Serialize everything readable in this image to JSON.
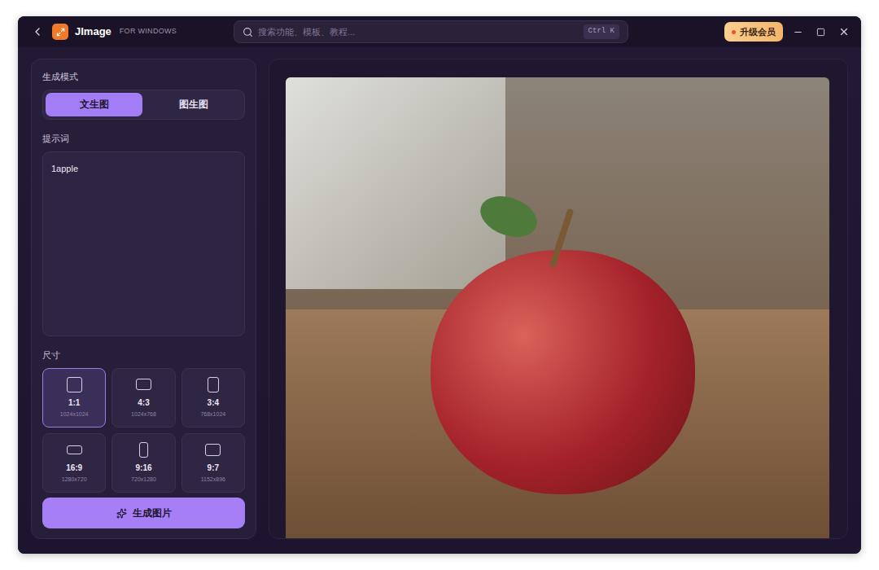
{
  "window": {
    "title": "JImage",
    "subtitle": "FOR WINDOWS"
  },
  "search": {
    "placeholder": "搜索功能、模板、教程...",
    "shortcut": "Ctrl K"
  },
  "upgrade_button": {
    "label": "升级会员"
  },
  "mode": {
    "label": "生成模式",
    "tabs": [
      {
        "label": "文生图",
        "selected": true
      },
      {
        "label": "图生图",
        "selected": false
      }
    ]
  },
  "prompt": {
    "label": "提示词",
    "value": "1apple"
  },
  "size": {
    "label": "尺寸",
    "options": [
      {
        "ratio": "1:1",
        "resolution": "1024x1024",
        "selected": true
      },
      {
        "ratio": "4:3",
        "resolution": "1024x768",
        "selected": false
      },
      {
        "ratio": "3:4",
        "resolution": "768x1024",
        "selected": false
      },
      {
        "ratio": "16:9",
        "resolution": "1280x720",
        "selected": false
      },
      {
        "ratio": "9:16",
        "resolution": "720x1280",
        "selected": false
      },
      {
        "ratio": "9:7",
        "resolution": "1152x896",
        "selected": false
      }
    ]
  },
  "generate_button": {
    "label": "生成图片"
  }
}
